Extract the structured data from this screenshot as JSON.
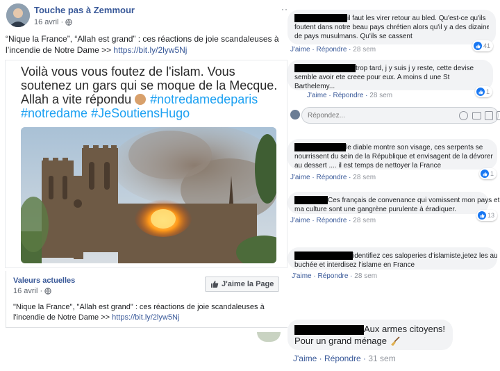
{
  "post": {
    "page_name": "Touche pas à Zemmour",
    "date": "16 avril ·",
    "caption_quote": "“Nique la France”, “Allah est grand” : ces réactions de joie scandaleuses à",
    "caption_line2": "l’incendie de Notre Dame >> ",
    "caption_link": "https://bit.ly/2lyw5Nj",
    "meme": {
      "line1": "Voilà vous vous foutez de l'islam. Vous",
      "line2": "soutenez un gars qui se moque de la Mecque.",
      "line3_prefix": "Allah a vite répondu ",
      "line3_tag": "#notredamedeparis",
      "line4": "#notredame #JeSoutiensHugo"
    },
    "shared_page": {
      "name": "Valeurs actuelles",
      "date": "16 avril ·",
      "like_button": "J'aime la Page",
      "text_line1": "\"Nique la France\", \"Allah est grand\" : ces réactions de joie scandaleuses à",
      "text_line2": "l'incendie de Notre Dame >> ",
      "link": "https://bit.ly/2lyw5Nj"
    }
  },
  "comments": [
    {
      "line1": "il faut les virer retour au bled. Qu'est-ce qu'ils",
      "line2": "foutent dans notre beau pays chrétien alors qu'il y a des dizaines",
      "line3": "de pays musulmans. Qu'ils se cassent",
      "like": "J'aime",
      "reply": "Répondre",
      "ago": "28 sem",
      "reactions": "41"
    },
    {
      "line1": "trop tard, j y suis j y reste, cette devise",
      "line2": "semble avoir ete creee pour eux. A moins d une St",
      "line3": "Barthelemy...",
      "like": "J'aime",
      "reply": "Répondre",
      "ago": "28 sem",
      "reactions": "1"
    },
    {
      "line1": "le diable montre son visage, ces serpents se",
      "line2": "nourrissent du sein de la République et envisagent de la dévorer",
      "line3": "au dessert .... il est temps de nettoyer la France",
      "like": "J'aime",
      "reply": "Répondre",
      "ago": "28 sem",
      "reactions": "1"
    },
    {
      "line1": "Ces français de convenance qui vomissent mon pays et",
      "line2": "ma culture sont une gangrène purulente à éradiquer.",
      "like": "J'aime",
      "reply": "Répondre",
      "ago": "28 sem",
      "reactions": "13"
    },
    {
      "line1": "identifiez ces saloperies d'islamiste,jetez les au",
      "line2": "buchée et interdisez l'islame en France",
      "like": "J'aime",
      "reply": "Répondre",
      "ago": "28 sem"
    },
    {
      "line1": "Aux armes citoyens!",
      "line2": "Pour un grand ménage",
      "like": "J'aime",
      "reply": "Répondre",
      "ago": "31 sem"
    }
  ],
  "reply_box": {
    "placeholder": "Répondez..."
  },
  "icons": {
    "more": "more-options-icon",
    "globe": "globe-icon",
    "like": "like-icon",
    "broom": "broom-icon",
    "emoji": "emoji-icon",
    "camera": "camera-icon",
    "gif": "gif-icon",
    "sticker": "sticker-icon",
    "clap": "clapping-hands-icon"
  },
  "colors": {
    "link": "#385898",
    "hashtag": "#1da1f2",
    "like_blue": "#1877f2",
    "redaction": "#000000"
  }
}
